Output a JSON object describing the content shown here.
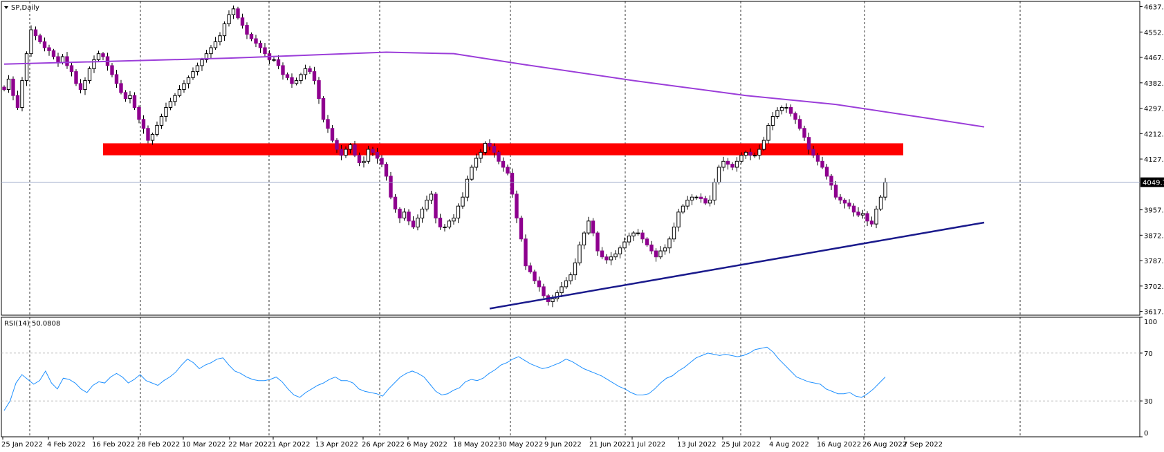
{
  "symbol_label": "SP,Daily",
  "rsi_label": "RSI(14) 50.0808",
  "current_price_label": "4049.7",
  "colors": {
    "bull_body": "#ffffff",
    "bull_wick": "#000000",
    "bear_body": "#8e008e",
    "ma_line": "#9b3dd9",
    "resistance_zone": "#ff0000",
    "trendline": "#1a1a8c",
    "rsi_line": "#1e90ff",
    "price_line": "#9aa7c7"
  },
  "chart_data": [
    {
      "type": "candlestick",
      "title": "SP,Daily",
      "y_axis_ticks": [
        "4637.5",
        "4552.5",
        "4467.5",
        "4382.5",
        "4297.5",
        "4212.5",
        "4127.5",
        "4049.7",
        "3957.5",
        "3872.5",
        "3787.5",
        "3702.5",
        "3617.5"
      ],
      "ylim": [
        3605,
        4655
      ],
      "x_axis_ticks": [
        "25 Jan 2022",
        "4 Feb 2022",
        "16 Feb 2022",
        "28 Feb 2022",
        "10 Mar 2022",
        "22 Mar 2022",
        "1 Apr 2022",
        "13 Apr 2022",
        "26 Apr 2022",
        "6 May 2022",
        "18 May 2022",
        "30 May 2022",
        "9 Jun 2022",
        "21 Jun 2022",
        "1 Jul 2022",
        "13 Jul 2022",
        "25 Jul 2022",
        "4 Aug 2022",
        "16 Aug 2022",
        "26 Aug 2022",
        "7 Sep 2022"
      ],
      "grid": "vertical-dashed",
      "series_close": [
        4360,
        4395,
        4340,
        4300,
        4390,
        4480,
        4560,
        4540,
        4520,
        4500,
        4490,
        4470,
        4450,
        4470,
        4440,
        4420,
        4380,
        4360,
        4390,
        4430,
        4460,
        4480,
        4470,
        4440,
        4410,
        4380,
        4350,
        4330,
        4340,
        4300,
        4260,
        4230,
        4190,
        4210,
        4240,
        4270,
        4300,
        4320,
        4340,
        4360,
        4380,
        4400,
        4420,
        4440,
        4460,
        4480,
        4500,
        4520,
        4540,
        4580,
        4610,
        4630,
        4600,
        4575,
        4545,
        4530,
        4515,
        4500,
        4480,
        4460,
        4460,
        4440,
        4410,
        4400,
        4380,
        4390,
        4410,
        4430,
        4420,
        4390,
        4330,
        4260,
        4230,
        4190,
        4160,
        4140,
        4160,
        4175,
        4140,
        4115,
        4120,
        4160,
        4150,
        4130,
        4110,
        4070,
        4000,
        3960,
        3930,
        3950,
        3920,
        3900,
        3930,
        3960,
        3990,
        4010,
        3930,
        3900,
        3900,
        3920,
        3930,
        3970,
        4000,
        4060,
        4100,
        4130,
        4150,
        4180,
        4170,
        4150,
        4120,
        4100,
        4080,
        4010,
        3930,
        3860,
        3770,
        3750,
        3720,
        3700,
        3670,
        3650,
        3660,
        3680,
        3700,
        3720,
        3740,
        3780,
        3840,
        3880,
        3920,
        3880,
        3820,
        3800,
        3790,
        3800,
        3810,
        3830,
        3850,
        3870,
        3880,
        3880,
        3860,
        3840,
        3820,
        3800,
        3820,
        3830,
        3860,
        3900,
        3950,
        3970,
        3990,
        4000,
        4000,
        3995,
        3980,
        3990,
        4050,
        4100,
        4120,
        4110,
        4100,
        4120,
        4140,
        4150,
        4140,
        4140,
        4160,
        4190,
        4240,
        4270,
        4290,
        4300,
        4300,
        4280,
        4260,
        4230,
        4200,
        4160,
        4140,
        4120,
        4100,
        4070,
        4040,
        4000,
        3990,
        3980,
        3970,
        3950,
        3940,
        3945,
        3920,
        3910,
        3960,
        4000,
        4049.7
      ]
    },
    {
      "type": "line",
      "title": "200-period moving average",
      "x_index": [
        0,
        50,
        85,
        100,
        115,
        140,
        165,
        185,
        205,
        218
      ],
      "values": [
        4445,
        4465,
        4485,
        4480,
        4445,
        4390,
        4340,
        4310,
        4265,
        4235
      ]
    },
    {
      "type": "area",
      "title": "resistance zone",
      "y_range": [
        4140,
        4180
      ],
      "x_index_range": [
        22,
        200
      ]
    },
    {
      "type": "line",
      "title": "support trendline",
      "points": [
        [
          108,
          3627
        ],
        [
          218,
          3915
        ]
      ]
    },
    {
      "type": "line",
      "title": "RSI(14)",
      "ylim": [
        0,
        100
      ],
      "y_axis_ticks": [
        "100",
        "70",
        "30",
        "0"
      ],
      "levels": [
        70,
        30
      ],
      "values": [
        22,
        30,
        45,
        52,
        48,
        44,
        47,
        55,
        45,
        40,
        49,
        48,
        45,
        40,
        37,
        43,
        46,
        45,
        50,
        53,
        50,
        45,
        48,
        52,
        47,
        45,
        43,
        47,
        50,
        54,
        60,
        65,
        62,
        57,
        60,
        62,
        65,
        66,
        60,
        55,
        53,
        50,
        48,
        47,
        47,
        48,
        50,
        46,
        40,
        35,
        33,
        37,
        40,
        43,
        45,
        48,
        50,
        47,
        47,
        45,
        40,
        38,
        37,
        36,
        34,
        40,
        45,
        50,
        53,
        55,
        53,
        50,
        44,
        38,
        35,
        36,
        39,
        41,
        46,
        48,
        47,
        49,
        53,
        56,
        60,
        62,
        65,
        67,
        64,
        61,
        59,
        57,
        58,
        60,
        62,
        65,
        63,
        60,
        57,
        55,
        53,
        51,
        48,
        45,
        42,
        40,
        37,
        35,
        35,
        36,
        40,
        45,
        49,
        51,
        55,
        58,
        62,
        66,
        68,
        70,
        69,
        68,
        69,
        68,
        67,
        68,
        70,
        73,
        74,
        75,
        71,
        65,
        60,
        55,
        50,
        48,
        46,
        45,
        44,
        40,
        38,
        36,
        36,
        37,
        34,
        33,
        36,
        40,
        45,
        50
      ]
    }
  ]
}
